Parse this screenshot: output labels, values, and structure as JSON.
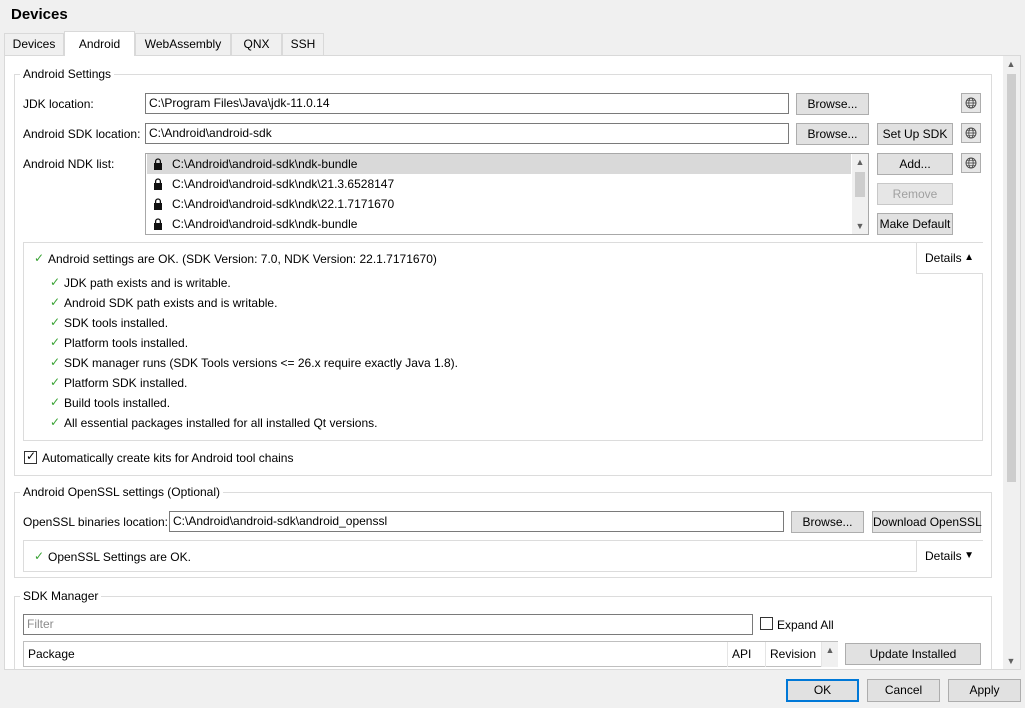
{
  "window": {
    "title": "Devices"
  },
  "tabs": [
    {
      "label": "Devices"
    },
    {
      "label": "Android"
    },
    {
      "label": "WebAssembly"
    },
    {
      "label": "QNX"
    },
    {
      "label": "SSH"
    }
  ],
  "android_settings": {
    "group_title": "Android Settings",
    "jdk": {
      "label": "JDK location:",
      "value": "C:\\Program Files\\Java\\jdk-11.0.14",
      "browse": "Browse..."
    },
    "sdk": {
      "label": "Android SDK location:",
      "value": "C:\\Android\\android-sdk",
      "browse": "Browse...",
      "setup": "Set Up SDK"
    },
    "ndk": {
      "label": "Android NDK list:",
      "items": [
        "C:\\Android\\android-sdk\\ndk-bundle",
        "C:\\Android\\android-sdk\\ndk\\21.3.6528147",
        "C:\\Android\\android-sdk\\ndk\\22.1.7171670",
        "C:\\Android\\android-sdk\\ndk-bundle"
      ],
      "add": "Add...",
      "remove": "Remove",
      "make_default": "Make Default"
    },
    "status": {
      "summary": "Android settings are OK. (SDK Version: 7.0, NDK Version: 22.1.7171670)",
      "details_label": "Details",
      "checks": [
        "JDK path exists and is writable.",
        "Android SDK path exists and is writable.",
        "SDK tools installed.",
        "Platform tools installed.",
        "SDK manager runs (SDK Tools versions <= 26.x require exactly Java 1.8).",
        "Platform SDK installed.",
        "Build tools installed.",
        "All essential packages installed for all installed Qt versions."
      ]
    },
    "auto_kits": {
      "label": "Automatically create kits for Android tool chains",
      "checked": true
    }
  },
  "openssl": {
    "group_title": "Android OpenSSL settings (Optional)",
    "label": "OpenSSL binaries location:",
    "value": "C:\\Android\\android-sdk\\android_openssl",
    "browse": "Browse...",
    "download": "Download OpenSSL",
    "status": "OpenSSL Settings are OK.",
    "details_label": "Details"
  },
  "sdk_manager": {
    "group_title": "SDK Manager",
    "filter_placeholder": "Filter",
    "expand_all": {
      "label": "Expand All",
      "checked": false
    },
    "columns": [
      "Package",
      "API",
      "Revision"
    ],
    "update_installed": "Update Installed"
  },
  "footer": {
    "ok": "OK",
    "cancel": "Cancel",
    "apply": "Apply"
  },
  "colors": {
    "accent": "#0078d7",
    "ok_check": "#3aa335"
  }
}
